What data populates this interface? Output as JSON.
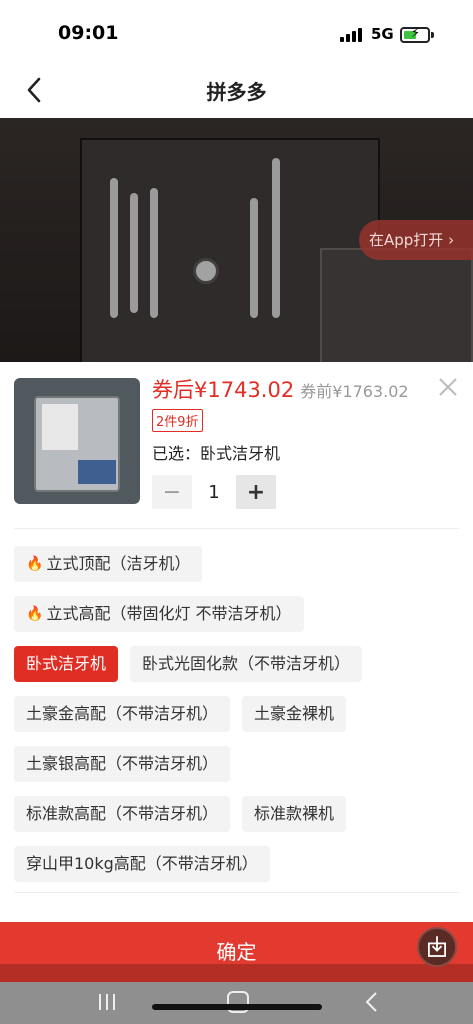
{
  "status_bar": {
    "time": "09:01",
    "network": "5G"
  },
  "nav": {
    "title": "拼多多"
  },
  "hero": {
    "open_app_label": "在App打开",
    "icons": [
      "back-arrow-icon",
      "chevron-right-icon"
    ]
  },
  "product": {
    "price_after": "券后¥1743.02",
    "price_before": "券前¥1763.02",
    "promo_badge": "2件9折",
    "selected_label": "已选：卧式洁牙机",
    "quantity": "1",
    "minus_label": "−",
    "plus_label": "+"
  },
  "options": [
    {
      "label": "立式顶配（洁牙机）",
      "hot": true,
      "active": false
    },
    {
      "label": "立式高配（带固化灯 不带洁牙机）",
      "hot": true,
      "active": false
    },
    {
      "label": "卧式洁牙机",
      "hot": false,
      "active": true
    },
    {
      "label": "卧式光固化款（不带洁牙机）",
      "hot": false,
      "active": false
    },
    {
      "label": "土豪金高配（不带洁牙机）",
      "hot": false,
      "active": false
    },
    {
      "label": "土豪金裸机",
      "hot": false,
      "active": false
    },
    {
      "label": "土豪银高配（不带洁牙机）",
      "hot": false,
      "active": false
    },
    {
      "label": "标准款高配（不带洁牙机）",
      "hot": false,
      "active": false
    },
    {
      "label": "标准款裸机",
      "hot": false,
      "active": false
    },
    {
      "label": "穿山甲10kg高配（不带洁牙机）",
      "hot": false,
      "active": false
    }
  ],
  "confirm_label": "确定",
  "colors": {
    "accent": "#e02e24",
    "confirm_bg": "#e23a2f"
  }
}
